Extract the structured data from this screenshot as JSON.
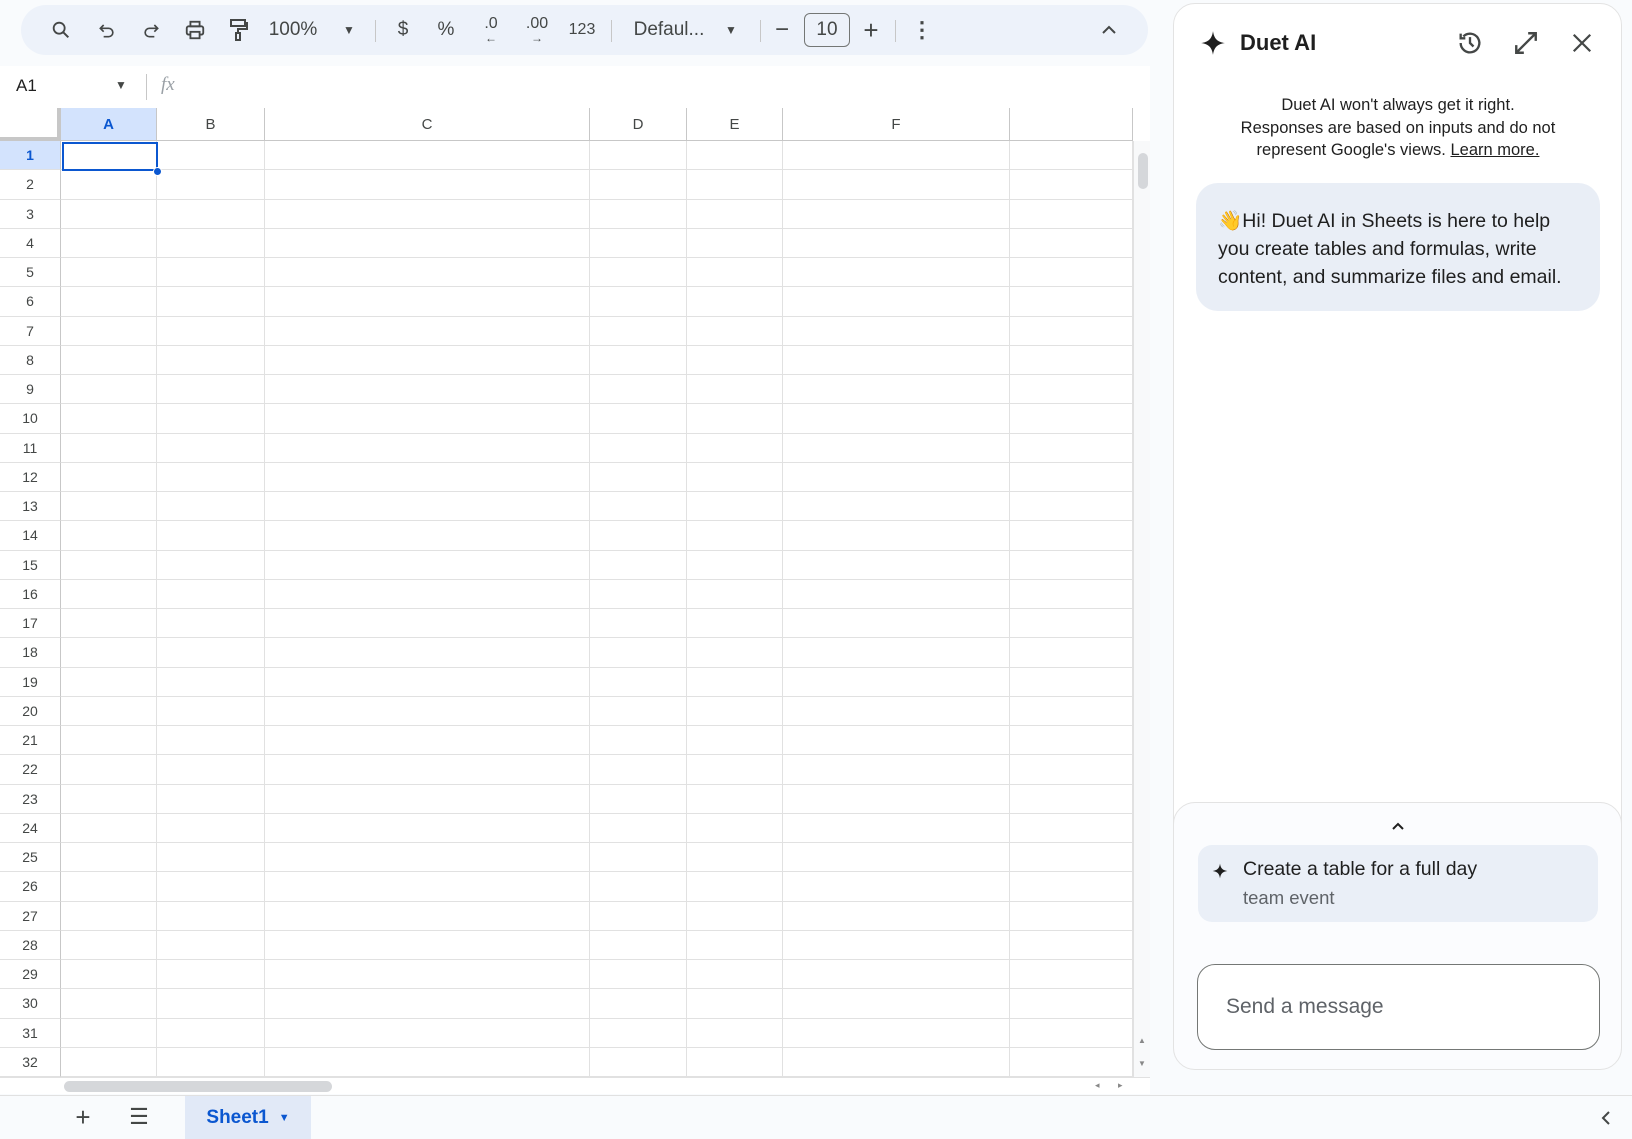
{
  "toolbar": {
    "zoom": "100%",
    "currency": "$",
    "percent": "%",
    "dec_decrease": ".0",
    "dec_increase": ".00",
    "format_more": "123",
    "font": "Defaul...",
    "font_size": "10"
  },
  "formula_bar": {
    "cell_ref": "A1",
    "fx": "fx",
    "value": ""
  },
  "grid": {
    "columns": [
      "A",
      "B",
      "C",
      "D",
      "E",
      "F",
      ""
    ],
    "selected_cell": "A1",
    "rows": [
      "1",
      "2",
      "3",
      "4",
      "5",
      "6",
      "7",
      "8",
      "9",
      "10",
      "11",
      "12",
      "13",
      "14",
      "15",
      "16",
      "17",
      "18",
      "19",
      "20",
      "21",
      "22",
      "23",
      "24",
      "25",
      "26",
      "27",
      "28",
      "29",
      "30",
      "31",
      "32"
    ]
  },
  "sheets": {
    "tabs": [
      {
        "label": "Sheet1",
        "active": true
      }
    ]
  },
  "panel": {
    "title": "Duet AI",
    "disclaimer_lines": [
      "Duet AI won't always get it right.",
      "Responses are based on inputs and do not",
      "represent Google's views."
    ],
    "learn_more": "Learn more.",
    "greeting_emoji": "👋",
    "greeting": "Hi! Duet AI in Sheets is here to help you create tables and formulas, write content, and summarize files and email.",
    "suggestion_main": "Create a table for a full day",
    "suggestion_rest": "team event",
    "input_placeholder": "Send a message"
  },
  "colors": {
    "accent": "#0b57d0",
    "toolbar_bg": "#edf2fa",
    "bubble_bg": "#e9eef6"
  }
}
